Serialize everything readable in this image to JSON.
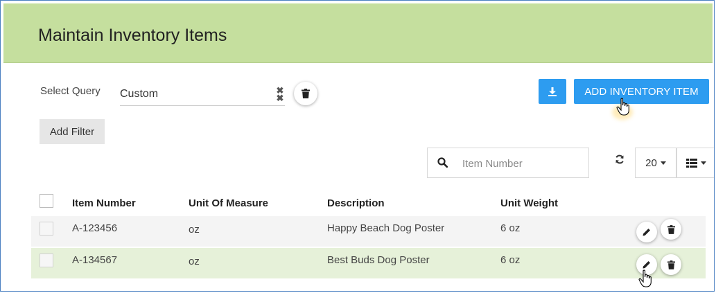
{
  "header": {
    "title": "Maintain Inventory Items"
  },
  "query": {
    "label": "Select Query",
    "value": "Custom"
  },
  "filters": {
    "add_filter_label": "Add Filter"
  },
  "toolbar": {
    "add_item_label": "ADD INVENTORY ITEM",
    "accent_color": "#2d9cf0"
  },
  "search": {
    "placeholder": "Item Number",
    "value": ""
  },
  "pagination": {
    "page_size": "20"
  },
  "table": {
    "columns": [
      "Item Number",
      "Unit Of Measure",
      "Description",
      "Unit Weight"
    ],
    "rows": [
      {
        "item_number": "A-123456",
        "unit": "oz",
        "description": "Happy Beach Dog Poster",
        "weight": "6 oz"
      },
      {
        "item_number": "A-134567",
        "unit": "oz",
        "description": "Best Buds Dog Poster",
        "weight": "6 oz"
      }
    ]
  },
  "colors": {
    "header_bg": "#c5df9e",
    "selected_row_bg": "#e6f1d9"
  }
}
